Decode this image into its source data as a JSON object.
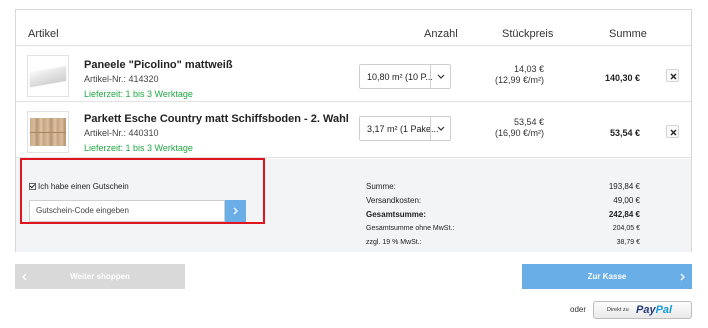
{
  "columns": {
    "artikel": "Artikel",
    "anzahl": "Anzahl",
    "stueckpreis": "Stückpreis",
    "summe": "Summe"
  },
  "items": [
    {
      "name": "Paneele \"Picolino\" mattweiß",
      "artikel_nr": "Artikel-Nr.: 414320",
      "lieferzeit": "Lieferzeit: 1 bis 3 Werktage",
      "quantity": "10,80 m² (10 P...",
      "unit_price": "14,03 €",
      "unit_price_per_m2": "(12,99 €/m²)",
      "total": "140,30 €",
      "image": "white-wall-panel"
    },
    {
      "name": "Parkett Esche Country matt Schiffsboden - 2. Wahl",
      "artikel_nr": "Artikel-Nr.: 440310",
      "lieferzeit": "Lieferzeit: 1 bis 3 Werktage",
      "quantity": "3,17 m² (1 Pake...",
      "unit_price": "53,54 €",
      "unit_price_per_m2": "(16,90 €/m²)",
      "total": "53,54 €",
      "image": "ash-parquet"
    }
  ],
  "coupon": {
    "checkbox_label": "Ich habe einen Gutschein",
    "checked": true,
    "placeholder": "Gutschein-Code eingeben"
  },
  "totals": [
    {
      "label": "Summe:",
      "value": "193,84 €"
    },
    {
      "label": "Versandkosten:",
      "value": "49,00 €"
    },
    {
      "label": "Gesamtsumme:",
      "value": "242,84 €"
    },
    {
      "label": "Gesamtsumme ohne MwSt.:",
      "value": "204,05 €"
    },
    {
      "label": "zzgl. 19 % MwSt.:",
      "value": "38,79 €"
    }
  ],
  "buttons": {
    "weiter": "Weiter shoppen",
    "kasse": "Zur Kasse",
    "oder": "oder",
    "paypal_direkt": "Direkt zu",
    "paypal_pay": "Pay",
    "paypal_pal": "Pal"
  },
  "colors": {
    "accent": "#6aaee8",
    "delivery_green": "#22a845",
    "highlight_red": "#e0141e",
    "disabled_gray": "#d9d9d9"
  }
}
